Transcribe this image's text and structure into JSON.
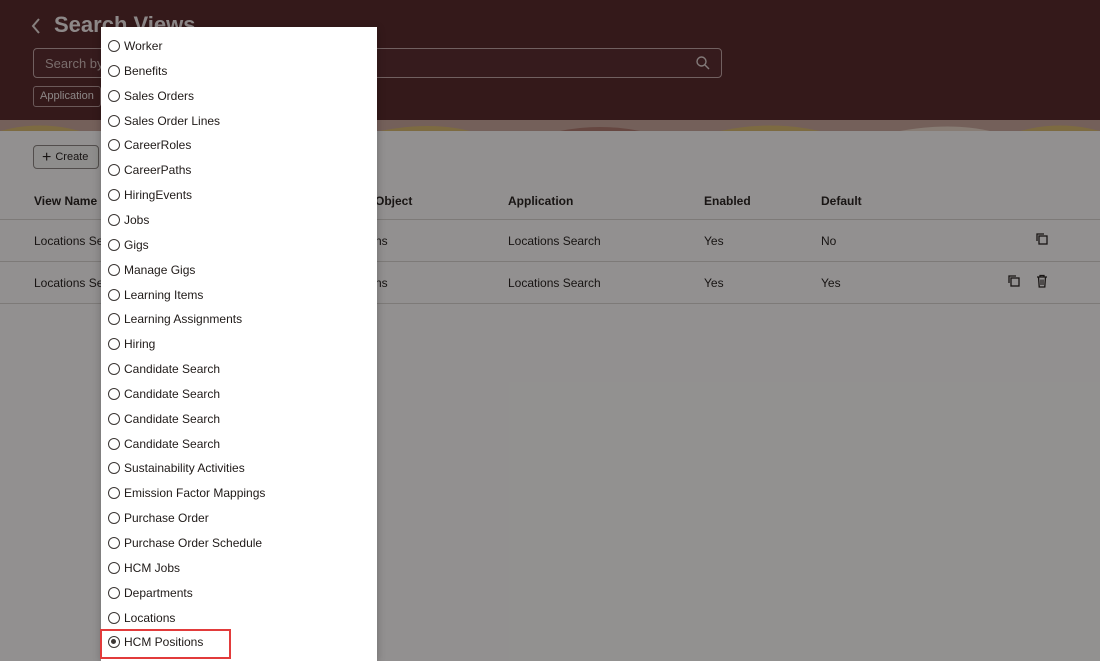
{
  "header": {
    "title": "Search Views",
    "search_placeholder": "Search by N",
    "chip_label": "Application"
  },
  "toolbar": {
    "create_label": "Create"
  },
  "table": {
    "columns": [
      "View Name",
      "Object",
      "Application",
      "Enabled",
      "Default"
    ],
    "rows": [
      {
        "view_name": "Locations Se",
        "object": "ns",
        "application": "Locations Search",
        "enabled": "Yes",
        "default": "No"
      },
      {
        "view_name": "Locations Se",
        "object": "ns",
        "application": "Locations Search",
        "enabled": "Yes",
        "default": "Yes"
      }
    ]
  },
  "dropdown": {
    "options": [
      "Worker",
      "Benefits",
      "Sales Orders",
      "Sales Order Lines",
      "CareerRoles",
      "CareerPaths",
      "HiringEvents",
      "Jobs",
      "Gigs",
      "Manage Gigs",
      "Learning Items",
      "Learning Assignments",
      "Hiring",
      "Candidate Search",
      "Candidate Search",
      "Candidate Search",
      "Candidate Search",
      "Sustainability Activities",
      "Emission Factor Mappings",
      "Purchase Order",
      "Purchase Order Schedule",
      "HCM Jobs",
      "Departments",
      "Locations",
      "HCM Positions"
    ],
    "selected": "HCM Positions"
  },
  "colors": {
    "header_bg": "#5a2b2e",
    "highlight_border": "#e23b3b"
  }
}
